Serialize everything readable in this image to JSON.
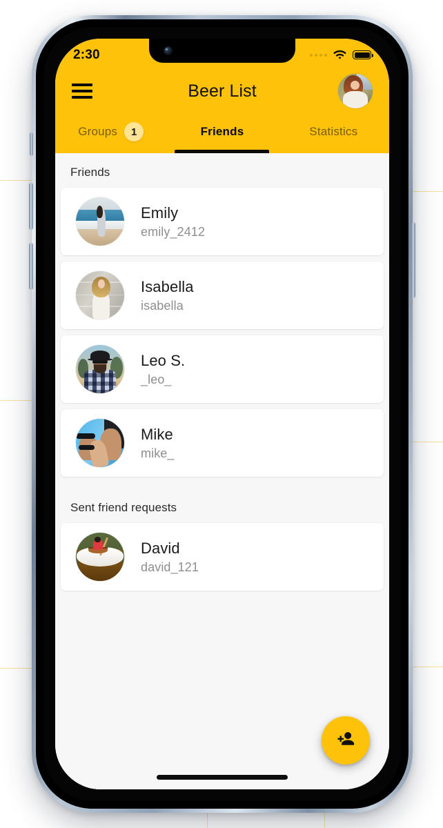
{
  "status_bar": {
    "time": "2:30",
    "signal_icon": "signal-dots-icon",
    "wifi_icon": "wifi-icon",
    "battery_icon": "battery-full-icon"
  },
  "app_bar": {
    "menu_icon": "hamburger-menu-icon",
    "title": "Beer List",
    "avatar_icon": "profile-avatar"
  },
  "tabs": [
    {
      "label": "Groups",
      "badge": "1",
      "active": false
    },
    {
      "label": "Friends",
      "badge": "",
      "active": true
    },
    {
      "label": "Statistics",
      "badge": "",
      "active": false
    }
  ],
  "sections": [
    {
      "header": "Friends",
      "items": [
        {
          "name": "Emily",
          "username": "emily_2412",
          "avatar": "emily-avatar"
        },
        {
          "name": "Isabella",
          "username": "isabella",
          "avatar": "isabella-avatar"
        },
        {
          "name": "Leo S.",
          "username": "_leo_",
          "avatar": "leo-avatar"
        },
        {
          "name": "Mike",
          "username": "mike_",
          "avatar": "mike-avatar"
        }
      ]
    },
    {
      "header": "Sent friend requests",
      "items": [
        {
          "name": "David",
          "username": "david_121",
          "avatar": "david-avatar"
        }
      ]
    }
  ],
  "fab": {
    "icon": "person-add-icon",
    "label": "Add friend"
  },
  "colors": {
    "brand_yellow": "#FFC20A",
    "badge_yellow": "#FFE495",
    "content_bg": "#F7F7F7",
    "card_bg": "#FFFFFF",
    "primary_text": "#1B1B1B",
    "secondary_text": "#8E8E8E",
    "tab_inactive": "#7A5D0A"
  },
  "home_indicator": "home-indicator"
}
